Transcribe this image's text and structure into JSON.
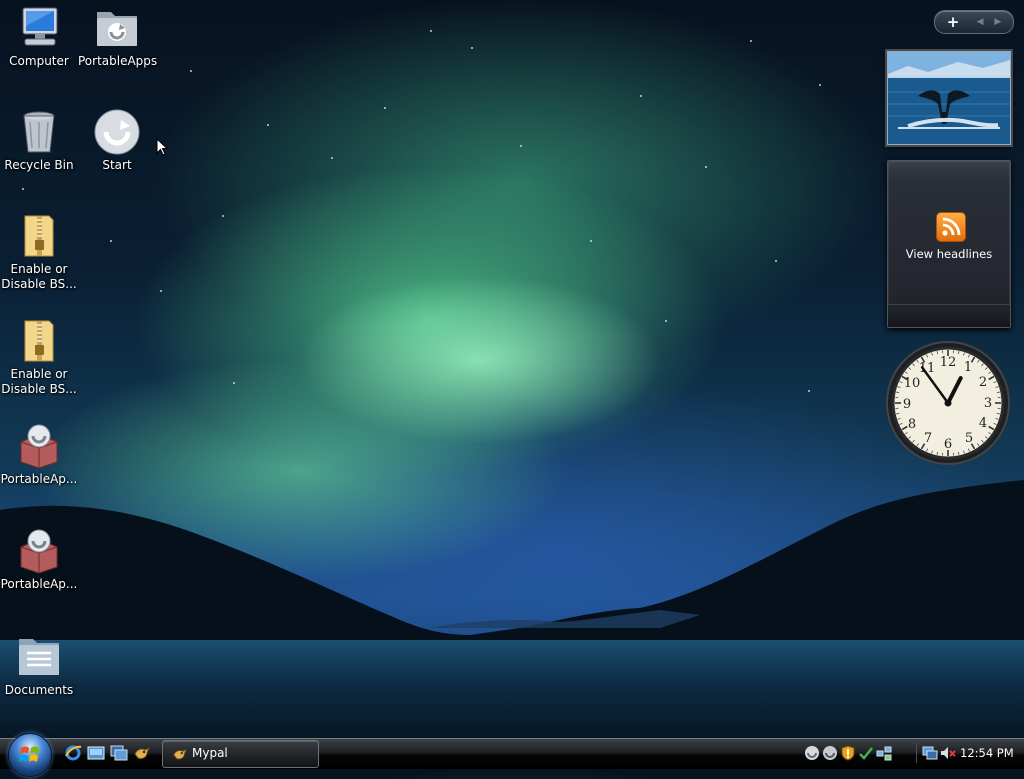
{
  "desktop": {
    "icons": [
      {
        "label": "Computer",
        "icon": "computer-icon"
      },
      {
        "label": "PortableApps",
        "icon": "folder-icon"
      },
      {
        "label": "Recycle Bin",
        "icon": "recycle-bin-icon"
      },
      {
        "label": "Start",
        "icon": "portableapps-start-icon"
      },
      {
        "label": "Enable or",
        "label2": "Disable BS...",
        "icon": "zip-folder-icon"
      },
      {
        "label": "Enable or",
        "label2": "Disable BS...",
        "icon": "zip-folder-icon"
      },
      {
        "label": "PortableAp...",
        "icon": "portableapps-package-icon"
      },
      {
        "label": "PortableAp...",
        "icon": "portableapps-package-icon"
      },
      {
        "label": "Documents",
        "icon": "documents-folder-icon"
      }
    ]
  },
  "sidebar": {
    "add_label": "+",
    "nav_label": "◀ ▶",
    "feed": {
      "label": "View headlines",
      "icon": "rss-icon"
    },
    "clock": {
      "hour": 12,
      "minute": 54
    }
  },
  "taskbar": {
    "quick_launch": [
      "internet-explorer-icon",
      "show-desktop-icon",
      "switch-windows-icon",
      "mypal-icon"
    ],
    "task": {
      "label": "Mypal",
      "icon": "mypal-icon"
    },
    "tray_icons": [
      "portableapps-tray-icon",
      "portableapps-tray-icon",
      "security-shield-icon",
      "update-check-icon",
      "network-icon",
      "remote-desktop-icon",
      "volume-muted-icon"
    ],
    "time": "12:54 PM"
  },
  "colors": {
    "accent": "#4b8ad6",
    "aurora": "#7fe3a8",
    "rss": "#f08a1c"
  }
}
